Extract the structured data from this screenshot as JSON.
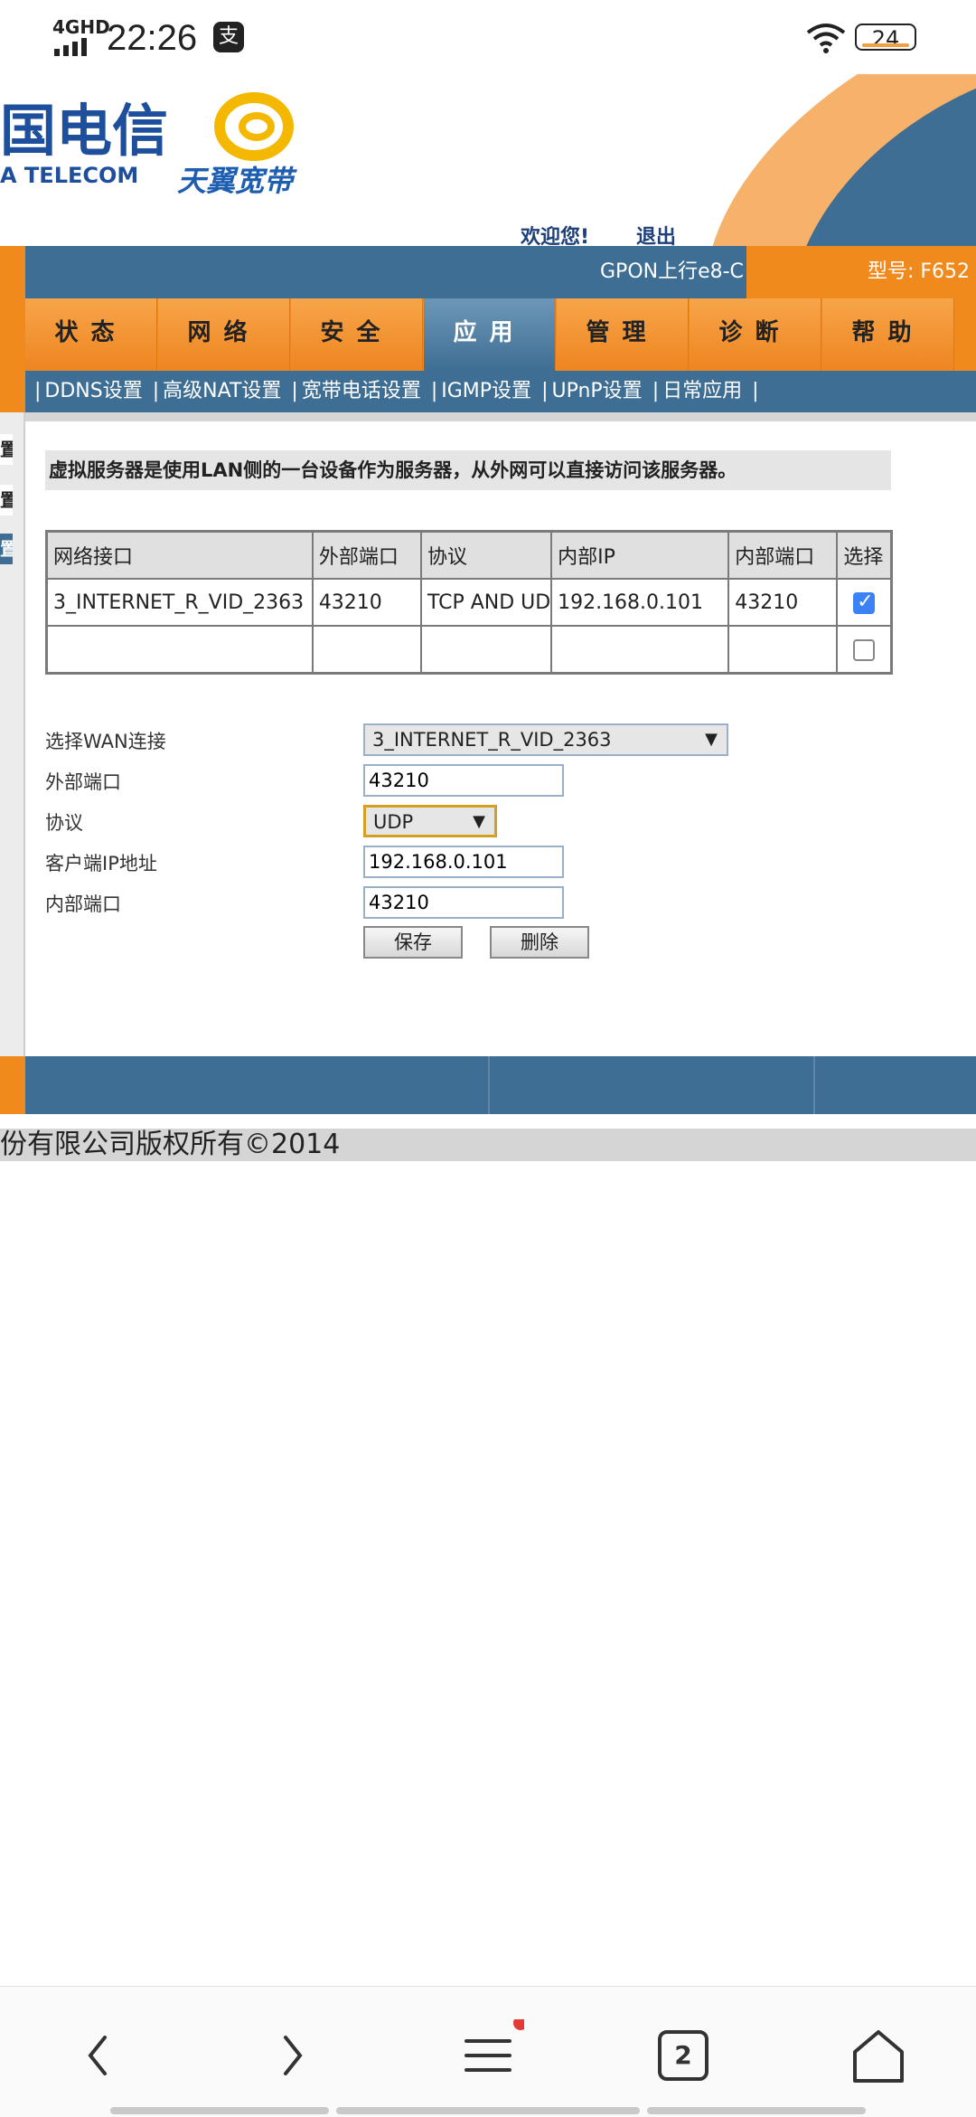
{
  "status_bar": {
    "network": "4GHD",
    "time": "22:26",
    "pay_icon": "支",
    "battery": "24"
  },
  "header": {
    "logo_cn": "国电信",
    "logo_en": "A TELECOM",
    "brand": "天翼宽带",
    "welcome": "欢迎您!",
    "logout": "退出",
    "product": "GPON上行e8-C",
    "model": "型号: F652"
  },
  "nav": {
    "tabs": [
      {
        "label": "状态"
      },
      {
        "label": "网络"
      },
      {
        "label": "安全"
      },
      {
        "label": "应用",
        "active": true
      },
      {
        "label": "管理"
      },
      {
        "label": "诊断"
      },
      {
        "label": "帮助"
      }
    ]
  },
  "submenu": {
    "lead_sep": "|",
    "items": [
      "DDNS设置",
      "高级NAT设置",
      "宽带电话设置",
      "IGMP设置",
      "UPnP设置",
      "日常应用"
    ]
  },
  "sidebar": {
    "items": [
      "置",
      "置",
      "置"
    ]
  },
  "notice": "虚拟服务器是使用LAN侧的一台设备作为服务器，从外网可以直接访问该服务器。",
  "table": {
    "headers": [
      "网络接口",
      "外部端口",
      "协议",
      "内部IP",
      "内部端口",
      "选择"
    ],
    "rows": [
      {
        "iface": "3_INTERNET_R_VID_2363",
        "ext_port": "43210",
        "protocol": "TCP AND UDP",
        "int_ip": "192.168.0.101",
        "int_port": "43210",
        "selected": true
      },
      {
        "iface": "",
        "ext_port": "",
        "protocol": "",
        "int_ip": "",
        "int_port": "",
        "selected": false
      }
    ]
  },
  "form": {
    "wan_label": "选择WAN连接",
    "wan_value": "3_INTERNET_R_VID_2363",
    "ext_port_label": "外部端口",
    "ext_port_value": "43210",
    "protocol_label": "协议",
    "protocol_value": "UDP",
    "client_ip_label": "客户端IP地址",
    "client_ip_value": "192.168.0.101",
    "int_port_label": "内部端口",
    "int_port_value": "43210",
    "save_label": "保存",
    "delete_label": "删除"
  },
  "footer": {
    "copyright": "份有限公司版权所有©2014"
  },
  "browser_bar": {
    "tab_count": "2"
  },
  "colors": {
    "orange": "#f08a1d",
    "blue": "#3e6e93",
    "checkbox_blue": "#3b82f6",
    "badge_red": "#e53935"
  }
}
